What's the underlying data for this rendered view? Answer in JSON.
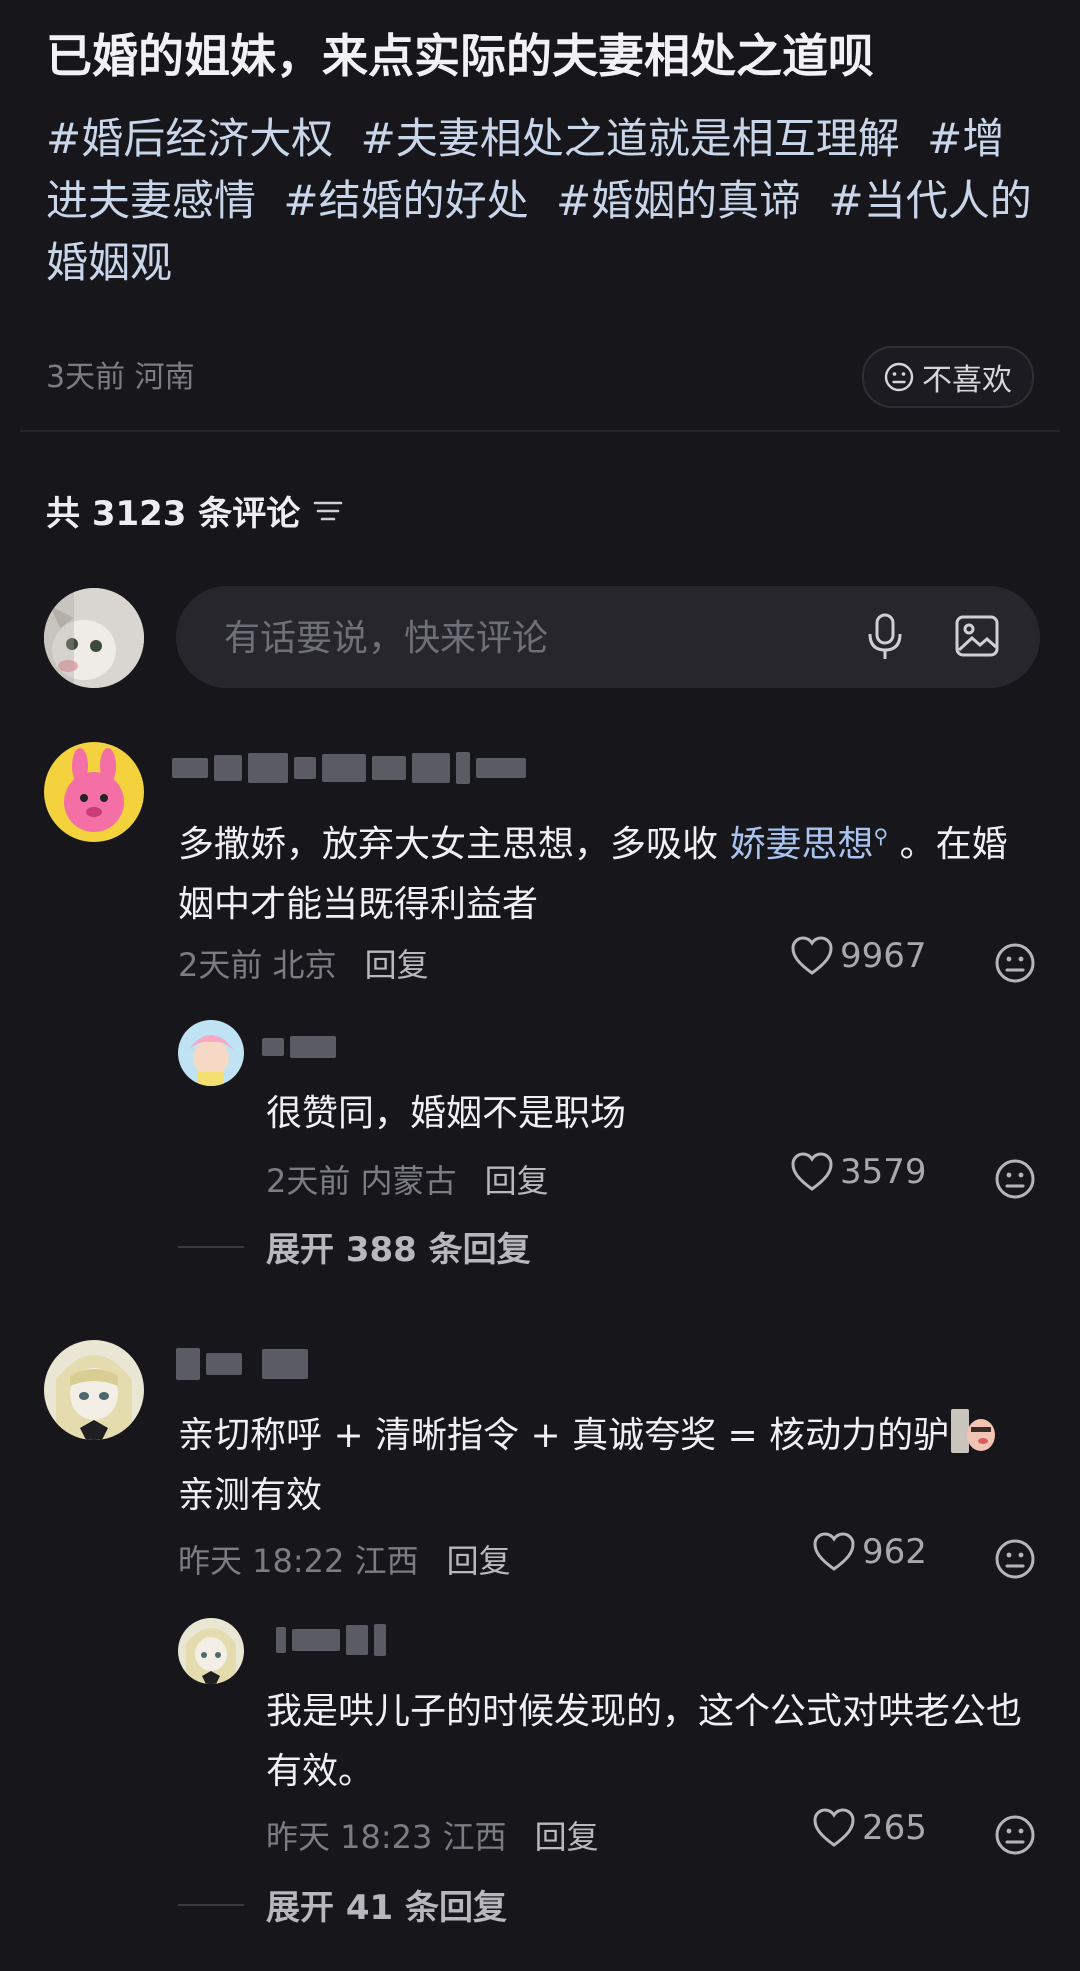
{
  "post": {
    "title": "已婚的姐妹，来点实际的夫妻相处之道呗",
    "tags": [
      "#婚后经济大权",
      "#夫妻相处之道就是相互理解",
      "#增进夫妻感情",
      "#结婚的好处",
      "#婚姻的真谛",
      "#当代人的婚姻观"
    ],
    "time": "3天前",
    "location": "河南",
    "dislike_label": "不喜欢"
  },
  "comments_header": {
    "count_text": "共 3123 条评论"
  },
  "comment_input": {
    "placeholder": "有话要说，快来评论"
  },
  "comments": [
    {
      "text_before": "多撒娇，放弃大女主思想，多吸收 ",
      "keyword": "娇妻思想",
      "text_after": " 。在婚姻中才能当既得利益者",
      "time": "2天前",
      "location": "北京",
      "reply_label": "回复",
      "likes": "9967",
      "reply": {
        "text": "很赞同，婚姻不是职场",
        "time": "2天前",
        "location": "内蒙古",
        "reply_label": "回复",
        "likes": "3579"
      },
      "expand_label": "展开 388 条回复"
    },
    {
      "text": "亲切称呼 + 清晰指令 + 真诚夸奖 = 核动力的驴",
      "text2": "亲测有效",
      "time": "昨天 18:22",
      "location": "江西",
      "reply_label": "回复",
      "likes": "962",
      "reply": {
        "text": "我是哄儿子的时候发现的，这个公式对哄老公也有效。",
        "time": "昨天 18:23",
        "location": "江西",
        "reply_label": "回复",
        "likes": "265"
      },
      "expand_label": "展开 41 条回复"
    }
  ],
  "colors": {
    "background": "#16161b",
    "tag": "#c9d6ea",
    "keyword": "#a9c3f0",
    "muted": "#7c7c84"
  },
  "icons": [
    "sort-icon",
    "mic-icon",
    "image-icon",
    "heart-icon",
    "meh-face-icon"
  ]
}
